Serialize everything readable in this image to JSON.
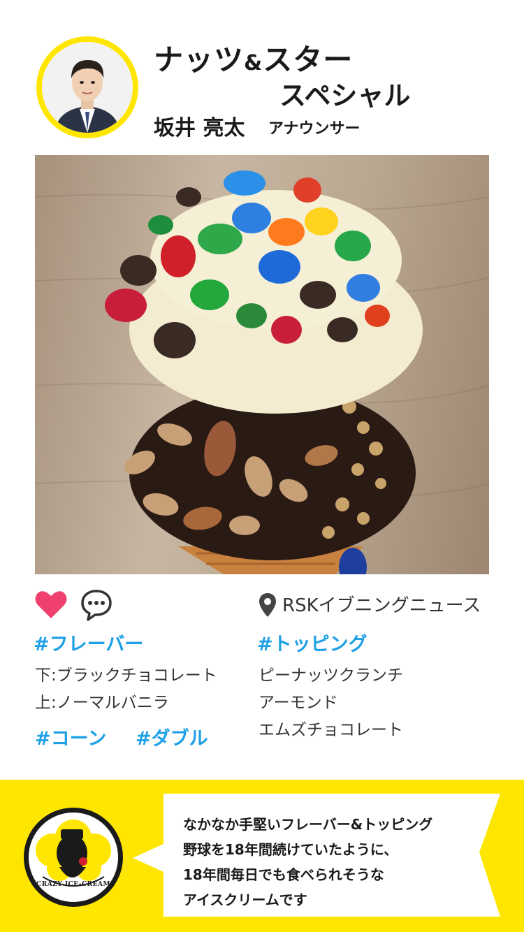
{
  "header": {
    "title_line1_a": "ナッツ",
    "title_line1_amp": "&",
    "title_line1_b": "スター",
    "title_line2": "スペシャル",
    "announcer_name": "坂井 亮太",
    "announcer_role": "アナウンサー"
  },
  "photo": {
    "subject": "ice-cream-cone-photo"
  },
  "actions": {
    "like_icon": "heart-icon",
    "comment_icon": "comment-icon",
    "location_icon": "location-pin-icon",
    "location": "RSKイブニングニュース",
    "heart_color": "#f0406e"
  },
  "flavor": {
    "tag": "#フレーバー",
    "items": [
      "下:ブラックチョコレート",
      "上:ノーマルバニラ"
    ]
  },
  "topping": {
    "tag": "#トッピング",
    "items": [
      "ピーナッツクランチ",
      "アーモンド",
      "エムズチョコレート"
    ]
  },
  "extra_tags": [
    "#コーン",
    "#ダブル"
  ],
  "comment": {
    "lines": [
      "なかなか手堅いフレーバー&トッピング",
      "野球を18年間続けていたように、",
      "18年間毎日でも食べられそうな",
      "アイスクリームです"
    ]
  },
  "logo": {
    "text": "CRAZY ICE-CREAM"
  },
  "colors": {
    "accent_yellow": "#ffe600",
    "tag_blue": "#1ea0e6"
  }
}
